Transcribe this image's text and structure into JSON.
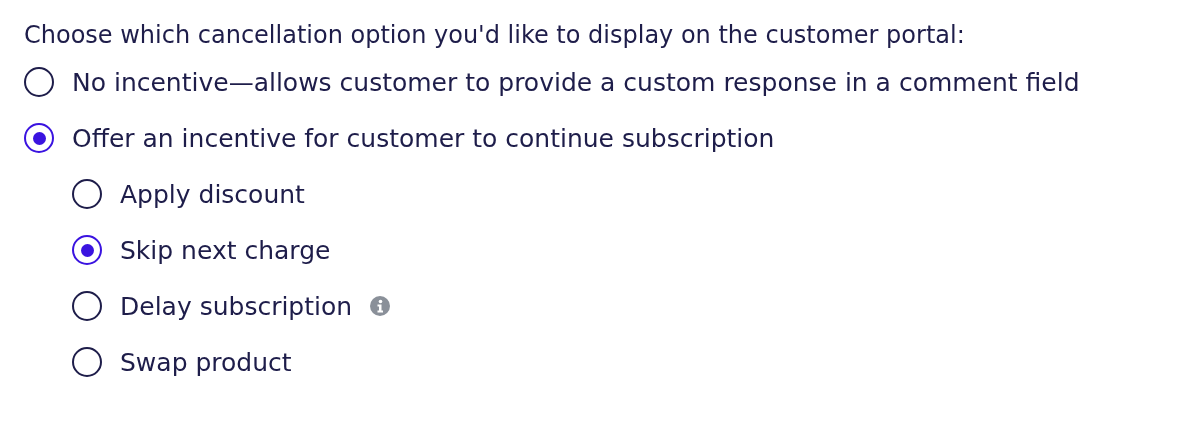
{
  "prompt": "Choose which cancellation option you'd like to display on the customer portal:",
  "options": [
    {
      "label": "No incentive—allows customer to provide a custom response in a comment field",
      "selected": false
    },
    {
      "label": "Offer an incentive for customer to continue subscription",
      "selected": true,
      "children": [
        {
          "label": "Apply discount",
          "selected": false
        },
        {
          "label": "Skip next charge",
          "selected": true
        },
        {
          "label": "Delay subscription",
          "selected": false,
          "info": true
        },
        {
          "label": "Swap product",
          "selected": false
        }
      ]
    }
  ]
}
